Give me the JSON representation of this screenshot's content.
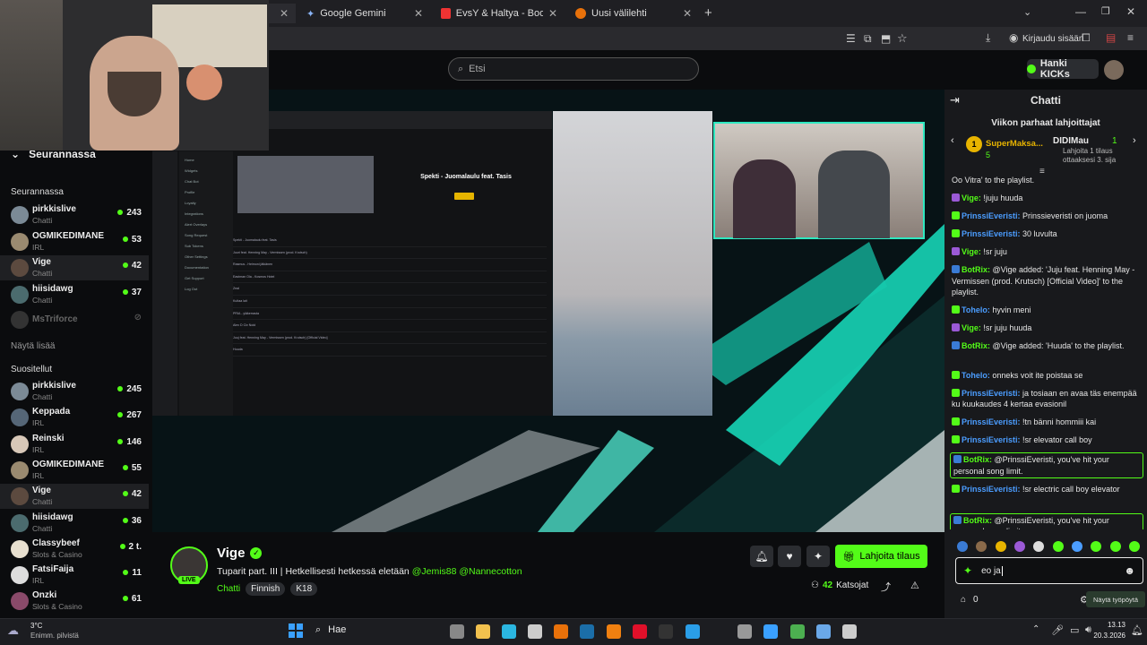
{
  "browser": {
    "tabs": [
      {
        "label": "Google Gemini",
        "color": "#8ab4f8"
      },
      {
        "label": "EvsY & Haltya - Boozy's Funky C",
        "color": "#e33"
      },
      {
        "label": "Uusi välilehti",
        "color": "#e8710a"
      }
    ],
    "login_label": "Kirjaudu sisään"
  },
  "site": {
    "search_placeholder": "Etsi",
    "kicks_label": "Hanki KICKs"
  },
  "sidebar": {
    "top_label": "Seurannassa",
    "following_title": "Seurannassa",
    "following": [
      {
        "name": "pirkkislive",
        "category": "Chatti",
        "viewers": "243",
        "color": "#7b8a96"
      },
      {
        "name": "OGMIKEDIMANE",
        "category": "IRL",
        "viewers": "53",
        "color": "#9a8a70"
      },
      {
        "name": "Vige",
        "category": "Chatti",
        "viewers": "42",
        "color": "#5c4a3f"
      },
      {
        "name": "hiisidawg",
        "category": "Chatti",
        "viewers": "37",
        "color": "#4b6b6e"
      }
    ],
    "offline": {
      "name": "MsTriforce"
    },
    "show_more": "Näytä lisää",
    "recommended_title": "Suositellut",
    "recommended": [
      {
        "name": "pirkkislive",
        "category": "Chatti",
        "viewers": "245",
        "color": "#7b8a96"
      },
      {
        "name": "Keppada",
        "category": "IRL",
        "viewers": "267",
        "color": "#556677"
      },
      {
        "name": "Reinski",
        "category": "IRL",
        "viewers": "146",
        "color": "#d8c8b8"
      },
      {
        "name": "OGMIKEDIMANE",
        "category": "IRL",
        "viewers": "55",
        "color": "#9a8a70"
      },
      {
        "name": "Vige",
        "category": "Chatti",
        "viewers": "42",
        "color": "#5c4a3f"
      },
      {
        "name": "hiisidawg",
        "category": "Chatti",
        "viewers": "36",
        "color": "#4b6b6e"
      },
      {
        "name": "Classybeef",
        "category": "Slots & Casino",
        "viewers": "2 t.",
        "color": "#e8e0d0"
      },
      {
        "name": "FatsiFaija",
        "category": "IRL",
        "viewers": "11",
        "color": "#ddd"
      },
      {
        "name": "Onzki",
        "category": "Slots & Casino",
        "viewers": "61",
        "color": "#8a4a6a"
      }
    ]
  },
  "stream_screen": {
    "song_title": "Spekti - Juomalaulu feat. Tasis",
    "playlist_rows": [
      "Spekti - Juomalaulu feat. Tasis",
      "Juuri feat. Henning May - Vermissen (prod. Krutsch)",
      "Rasmus - Heimoni jätkänen",
      "Eastman Ola - Kosmos Hotel",
      "Zeal",
      "Kultaa lait",
      "PRIA - yläkerrasta",
      "Alex D Civ Noid",
      "Juuj feat. Henning May - Vermissen (prod. Krutsch) [Official Video]",
      "Huuda"
    ],
    "menu": [
      "Home",
      "Widgets",
      "Chat Bot",
      "Profile",
      "Loyalty",
      "Integrations",
      "Alert Overlays",
      "Song Request",
      "Sub Tokens",
      "Other Settings",
      "Documentation",
      "Get Support",
      "Log Out"
    ]
  },
  "stream_info": {
    "channel": "Vige",
    "title": "Tuparit part. III | Hetkellisesti hetkessä eletään",
    "mentions": "@Jemis88 @Nannecotton",
    "category": "Chatti",
    "tags": [
      "Finnish",
      "K18"
    ],
    "live_badge": "LIVE",
    "gift_button": "Lahjoita tilaus",
    "viewers_count": "42",
    "viewers_label": "Katsojat"
  },
  "chat": {
    "title": "Chatti",
    "top_gifters_title": "Viikon parhaat lahjoittajat",
    "gifter1": {
      "name": "SuperMaksa...",
      "count": "5"
    },
    "gifter2": {
      "name": "DIDIMau",
      "count": "1",
      "note": "Lahjoita 1 tilaus ottaaksesi 3. sija"
    },
    "messages": [
      {
        "user": "",
        "text": "Oo Vitra' to the playlist.",
        "color": "#ddd",
        "badge": ""
      },
      {
        "user": "Vige:",
        "text": "!juju huuda",
        "color": "#53fc18",
        "badge": "#9b59d6"
      },
      {
        "user": "PrinssiEveristi:",
        "text": "Prinssieveristi on juoma",
        "color": "#4b9dff",
        "badge": "#53fc18"
      },
      {
        "user": "PrinssiEveristi:",
        "text": "30 luvulta",
        "color": "#4b9dff",
        "badge": "#53fc18"
      },
      {
        "user": "Vige:",
        "text": "!sr juju",
        "color": "#53fc18",
        "badge": "#9b59d6"
      },
      {
        "user": "BotRix:",
        "text": "@Vige added: 'Juju feat. Henning May - Vermissen (prod. Krutsch) [Official Video]' to the playlist.",
        "color": "#53fc18",
        "badge": "#3a7bd5"
      },
      {
        "user": "Tohelo:",
        "text": "hyvin meni",
        "color": "#4b9dff",
        "badge": "#53fc18"
      },
      {
        "user": "Vige:",
        "text": "!sr juju huuda",
        "color": "#53fc18",
        "badge": "#9b59d6"
      },
      {
        "user": "BotRix:",
        "text": "@Vige added: 'Huuda' to the playlist.",
        "color": "#53fc18",
        "badge": "#3a7bd5"
      },
      {
        "user": "Tohelo:",
        "text": "onneks voit ite poistaa se",
        "color": "#4b9dff",
        "badge": "#53fc18"
      },
      {
        "user": "PrinssiEveristi:",
        "text": "ja tosiaan en avaa täs enempää ku kuukaudes 4 kertaa evasionil",
        "color": "#4b9dff",
        "badge": "#53fc18"
      },
      {
        "user": "PrinssiEveristi:",
        "text": "!tn bänni hommiii kai",
        "color": "#4b9dff",
        "badge": "#53fc18"
      },
      {
        "user": "PrinssiEveristi:",
        "text": "!sr elevator call boy",
        "color": "#4b9dff",
        "badge": "#53fc18"
      },
      {
        "user": "BotRix:",
        "text": "@PrinssiEveristi, you've hit your personal song limit.",
        "color": "#53fc18",
        "badge": "#3a7bd5",
        "hl": true
      },
      {
        "user": "PrinssiEveristi:",
        "text": "!sr electric call boy elevator",
        "color": "#4b9dff",
        "badge": "#53fc18"
      },
      {
        "user": "BotRix:",
        "text": "@PrinssiEveristi, you've hit your personal song limit.",
        "color": "#53fc18",
        "badge": "#3a7bd5",
        "hl": true
      }
    ],
    "input_value": "eo ja",
    "points": "0",
    "show_pane_button": "Näytä työpöytä"
  },
  "taskbar": {
    "weather_temp": "3°C",
    "weather_desc": "Enimm. pilvistä",
    "search_label": "Hae",
    "time": "13.13",
    "date": "20.3.2026"
  },
  "colors": {
    "accent": "#53fc18",
    "bg": "#0b0c0e",
    "panel": "#18191c"
  }
}
